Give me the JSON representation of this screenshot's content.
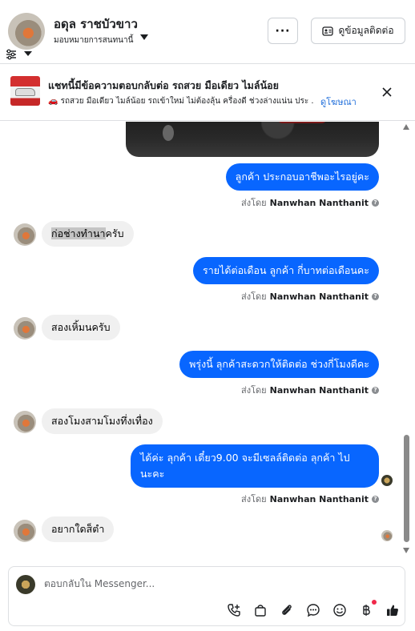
{
  "header": {
    "name": "อดุล ราชบัวขาว",
    "assignee": "มอบหมายการสนทนานี้",
    "more_label": "···",
    "contact_label": "ดูข้อมูลติดต่อ"
  },
  "ad": {
    "title": "แชทนี้มีข้อความตอบกลับต่อ รถสวย มือเดียว ไมล์น้อย",
    "subtitle": "🚗 รถสวย มือเดียว ไมล์น้อย รถเข้าใหม่ ไม่ต้องลุ้น ครื่องดี ช่วงล่างแน่น ประ ...",
    "link": "ดูโฆษณา"
  },
  "messages": [
    {
      "side": "out",
      "text": "ลูกค้า ประกอบอาชีพอะไรอยู่คะ"
    },
    {
      "side": "sent_by",
      "prefix": "ส่งโดย",
      "name": "Nanwhan Nanthanit"
    },
    {
      "side": "in",
      "highlight": "ก่อช่างทำนา",
      "text": "ครับ"
    },
    {
      "side": "out",
      "text": "รายได้ต่อเดือน ลูกค้า  กี่บาทต่อเดือนคะ"
    },
    {
      "side": "sent_by",
      "prefix": "ส่งโดย",
      "name": "Nanwhan Nanthanit"
    },
    {
      "side": "in",
      "text": "สองเหิ้มนครับ"
    },
    {
      "side": "out",
      "text": "พรุ่งนี้ ลุกค้าสะดวกให้ติดต่อ ช่วงกี่โมงดีคะ"
    },
    {
      "side": "sent_by",
      "prefix": "ส่งโดย",
      "name": "Nanwhan Nanthanit"
    },
    {
      "side": "in",
      "text": "สองโมงสามโมงทึ่งเทื่อง"
    },
    {
      "side": "out",
      "line1": "ได้ค่ะ  ลุกค้า  เดี๋ยว9.00 จะมีเซลล์ติดต่อ ลุกค้า ไป",
      "line2": "นะคะ"
    },
    {
      "side": "sent_by",
      "prefix": "ส่งโดย",
      "name": "Nanwhan Nanthanit"
    },
    {
      "side": "in",
      "text": "อยากใดส็ตำ"
    }
  ],
  "composer": {
    "placeholder": "ตอบกลับใน Messenger..."
  },
  "toolbar_icons": [
    "phone-plus-icon",
    "shopping-bag-icon",
    "paperclip-icon",
    "chat-bubble-icon",
    "smiley-icon",
    "baht-icon",
    "thumbs-up-icon"
  ],
  "colors": {
    "outgoing_bubble": "#0866ff",
    "incoming_bubble": "#f0f0f0",
    "link": "#216fdb",
    "notification_dot": "#f02849"
  }
}
